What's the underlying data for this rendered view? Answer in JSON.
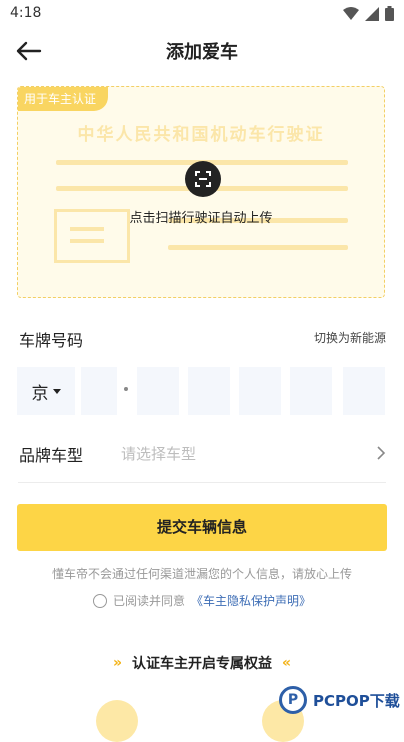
{
  "status": {
    "time": "4:18"
  },
  "header": {
    "title": "添加爱车"
  },
  "scan_card": {
    "tag": "用于车主认证",
    "watermark": "中华人民共和国机动车行驶证",
    "scan_text": "点击扫描行驶证自动上传"
  },
  "plate": {
    "label": "车牌号码",
    "switch_label": "切换为新能源",
    "province": "京"
  },
  "brand": {
    "label": "品牌车型",
    "placeholder": "请选择车型"
  },
  "submit_label": "提交车辆信息",
  "privacy_note": "懂车帝不会通过任何渠道泄漏您的个人信息，请放心上传",
  "agree": {
    "prefix": "已阅读并同意",
    "link": "《车主隐私保护声明》"
  },
  "benefits": {
    "title": "认证车主开启专属权益"
  },
  "watermark_logo": {
    "text": "PCPOP下载",
    "mark": "P"
  },
  "colors": {
    "accent": "#fdd546",
    "card_bg": "#fffbea",
    "link": "#3d6db5"
  }
}
